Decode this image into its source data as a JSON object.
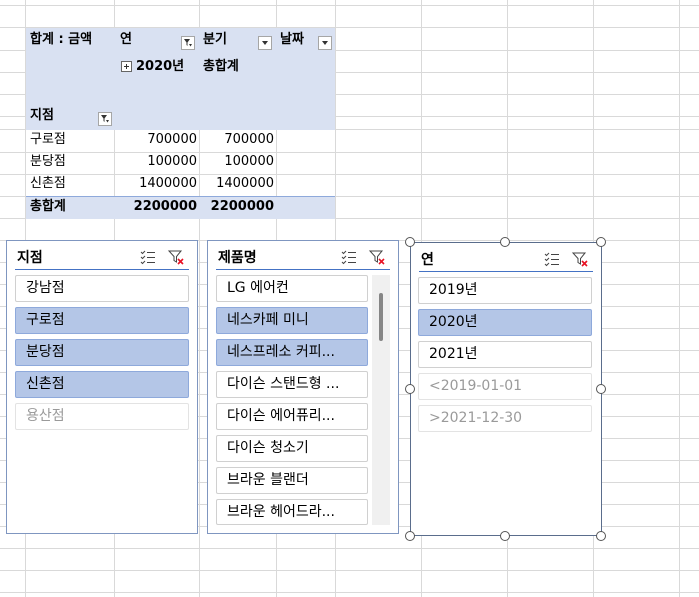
{
  "pivot": {
    "corner_label": "합계 : 금액",
    "col_field_year": "연",
    "col_field_quarter": "분기",
    "col_field_date": "날짜",
    "year_header": "2020년",
    "grand_total_header": "총합계",
    "row_field": "지점",
    "rows": [
      {
        "label": "구로점",
        "value": "700000",
        "total": "700000"
      },
      {
        "label": "분당점",
        "value": "100000",
        "total": "100000"
      },
      {
        "label": "신촌점",
        "value": "1400000",
        "total": "1400000"
      }
    ],
    "total_row": {
      "label": "총합계",
      "value": "2200000",
      "total": "2200000"
    }
  },
  "slicers": [
    {
      "title": "지점",
      "items": [
        {
          "label": "강남점",
          "state": "normal"
        },
        {
          "label": "구로점",
          "state": "selected"
        },
        {
          "label": "분당점",
          "state": "selected"
        },
        {
          "label": "신촌점",
          "state": "selected"
        },
        {
          "label": "용산점",
          "state": "dimmed"
        }
      ]
    },
    {
      "title": "제품명",
      "items": [
        {
          "label": "LG 에어컨",
          "state": "normal"
        },
        {
          "label": "네스카페 미니",
          "state": "selected"
        },
        {
          "label": "네스프레소 커피...",
          "state": "selected"
        },
        {
          "label": "다이슨 스탠드형 ...",
          "state": "normal"
        },
        {
          "label": "다이슨 에어퓨리...",
          "state": "normal"
        },
        {
          "label": "다이슨 청소기",
          "state": "normal"
        },
        {
          "label": "브라운 블랜더",
          "state": "normal"
        },
        {
          "label": "브라운 헤어드라...",
          "state": "normal"
        }
      ]
    },
    {
      "title": "연",
      "items": [
        {
          "label": "2019년",
          "state": "normal"
        },
        {
          "label": "2020년",
          "state": "selected"
        },
        {
          "label": "2021년",
          "state": "normal"
        },
        {
          "label": "<2019-01-01",
          "state": "dimmed"
        },
        {
          "label": ">2021-12-30",
          "state": "dimmed"
        }
      ]
    }
  ],
  "icons": {
    "multiselect": "multi-select-icon",
    "clearfilter": "clear-filter-icon",
    "filter": "filter-dropdown-icon",
    "expand": "expand-plus-icon"
  },
  "colors": {
    "pivot_header": "#d9e1f2",
    "selected_item": "#b4c6e7",
    "slicer_border": "#4472c4",
    "clear_filter_red": "#e81123"
  }
}
